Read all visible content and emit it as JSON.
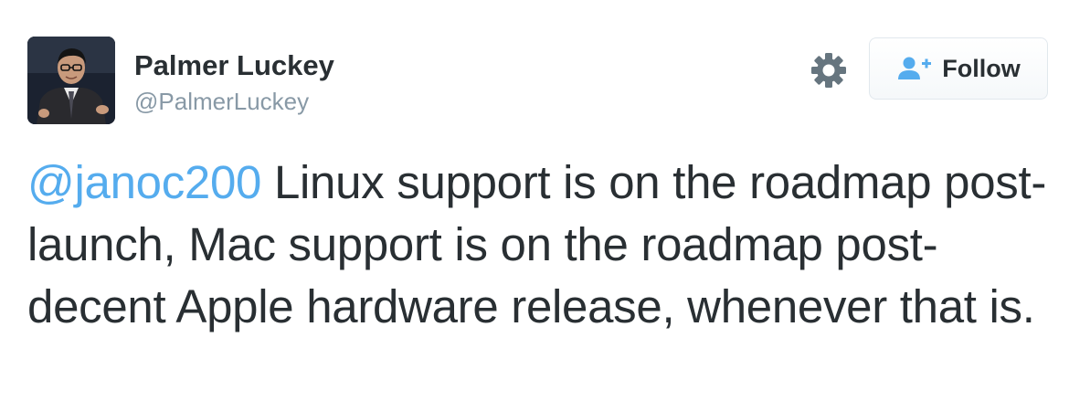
{
  "user": {
    "name": "Palmer Luckey",
    "handle": "@PalmerLuckey",
    "avatar_icon": "avatar-photo"
  },
  "actions": {
    "settings_icon": "gear-icon",
    "follow_icon": "add-user-icon",
    "follow_label": "Follow"
  },
  "tweet": {
    "mention": "@janoc200",
    "text": " Linux support is on the roadmap post-launch, Mac support is on the roadmap post-decent Apple hardware release, whenever that is."
  },
  "colors": {
    "text": "#292f33",
    "muted": "#8899a6",
    "link": "#55acee",
    "icon": "#66757f"
  }
}
